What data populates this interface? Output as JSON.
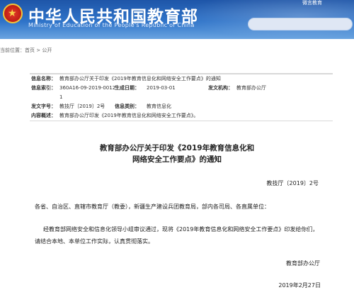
{
  "header": {
    "site_title": "中华人民共和国教育部",
    "site_subtitle": "Ministry of Education of the People's Republic of China",
    "weibo_link": "微言教育",
    "emblem_icon": "national-emblem"
  },
  "breadcrumb": {
    "prefix": "当前位置：",
    "home": "首页",
    "separator": " > ",
    "current": "公开"
  },
  "meta": {
    "info_name_label": "信息名称：",
    "info_name": "教育部办公厅关于印发《2019年教育信息化和网络安全工作要点》的通知",
    "index_label": "信息索引：",
    "index_value": "360A16-09-2019-0012-",
    "index_value_2": "1",
    "date_label": "生成日期：",
    "date_value": "2019-03-01",
    "issuer_label": "发文机构：",
    "issuer_value": "教育部办公厅",
    "doc_no_label": "发文字号：",
    "doc_no_value": "教技厅〔2019〕2号",
    "category_label": "信息类别：",
    "category_value": "教育信息化",
    "summary_label": "内容概述：",
    "summary_value": "教育部办公厅印发《2019年教育信息化和网络安全工作要点》。"
  },
  "article": {
    "title_line1": "教育部办公厅关于印发《2019年教育信息化和",
    "title_line2": "网络安全工作要点》的通知",
    "doc_number": "教技厅〔2019〕2号",
    "recipients": "各省、自治区、直辖市教育厅（教委），新疆生产建设兵团教育局，部内各司局、各直属单位：",
    "body_line1": "经教育部网络安全和信息化领导小组审议通过，现将《2019年教育信息化和网络安全工作要点》印发给你们，",
    "body_line2": "请结合本地、本单位工作实际，认真贯彻落实。",
    "signature": "教育部办公厅",
    "sign_date": "2019年2月27日"
  }
}
